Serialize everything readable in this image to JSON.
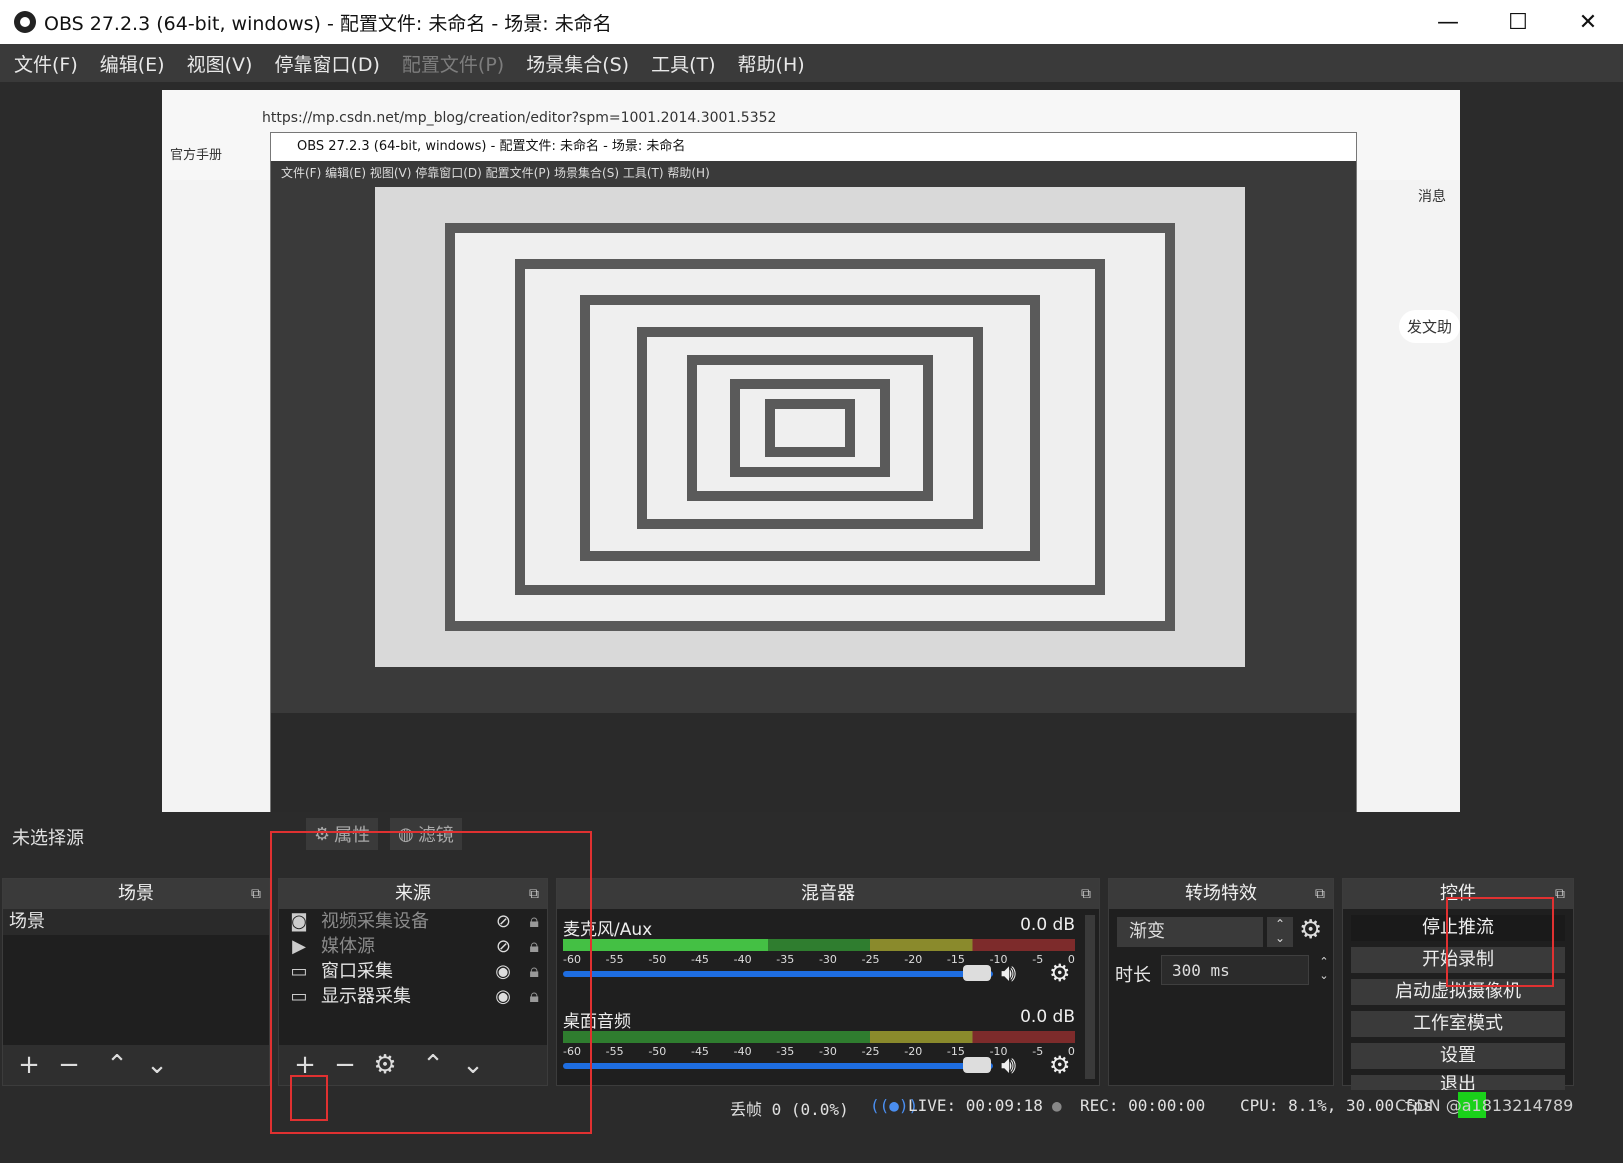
{
  "window": {
    "title": "OBS 27.2.3 (64-bit, windows) - 配置文件: 未命名 - 场景: 未命名",
    "minimize": "—",
    "maximize": "☐",
    "close": "✕"
  },
  "menu": {
    "file": "文件(F)",
    "edit": "编辑(E)",
    "view": "视图(V)",
    "docks": "停靠窗口(D)",
    "profile": "配置文件(P)",
    "scene_collection": "场景集合(S)",
    "tools": "工具(T)",
    "help": "帮助(H)"
  },
  "preview": {
    "url": "https://mp.csdn.net/mp_blog/creation/editor?spm=1001.2014.3001.5352",
    "bookmark": "官方手册",
    "nested_title": "OBS 27.2.3 (64-bit, windows) - 配置文件: 未命名 - 场景: 未命名",
    "nested_menu": "文件(F)  编辑(E)  视图(V)  停靠窗口(D)  配置文件(P)  场景集合(S)  工具(T)  帮助(H)",
    "notice": "消息",
    "post_label": "发文助"
  },
  "source_toolbar": {
    "no_source": "未选择源",
    "properties": "属性",
    "filters": "滤镜"
  },
  "scenes": {
    "header": "场景",
    "items": [
      "场景"
    ]
  },
  "sources": {
    "header": "来源",
    "items": [
      {
        "label": "视频采集设备",
        "icon": "camera-icon",
        "visible": false
      },
      {
        "label": "媒体源",
        "icon": "play-icon",
        "visible": false
      },
      {
        "label": "窗口采集",
        "icon": "window-icon",
        "visible": true
      },
      {
        "label": "显示器采集",
        "icon": "monitor-icon",
        "visible": true
      }
    ]
  },
  "mixer": {
    "header": "混音器",
    "tracks": [
      {
        "name": "麦克风/Aux",
        "db": "0.0 dB"
      },
      {
        "name": "桌面音频",
        "db": "0.0 dB"
      }
    ],
    "ticks": [
      "-60",
      "-55",
      "-50",
      "-45",
      "-40",
      "-35",
      "-30",
      "-25",
      "-20",
      "-15",
      "-10",
      "-5",
      "0"
    ]
  },
  "transitions": {
    "header": "转场特效",
    "selected": "渐变",
    "duration_label": "时长",
    "duration_value": "300 ms"
  },
  "controls": {
    "header": "控件",
    "stop_stream": "停止推流",
    "start_record": "开始录制",
    "virtual_cam": "启动虚拟摄像机",
    "studio_mode": "工作室模式",
    "settings": "设置",
    "exit": "退出"
  },
  "status": {
    "dropped": "丢帧 0 (0.0%)",
    "live": "LIVE: 00:09:18",
    "rec": "REC: 00:00:00",
    "cpu": "CPU: 8.1%, 30.00 fps",
    "watermark": "CSDN @a1813214789"
  },
  "colors": {
    "annotation": "#e03131",
    "accent_slider": "#1e6de0"
  }
}
